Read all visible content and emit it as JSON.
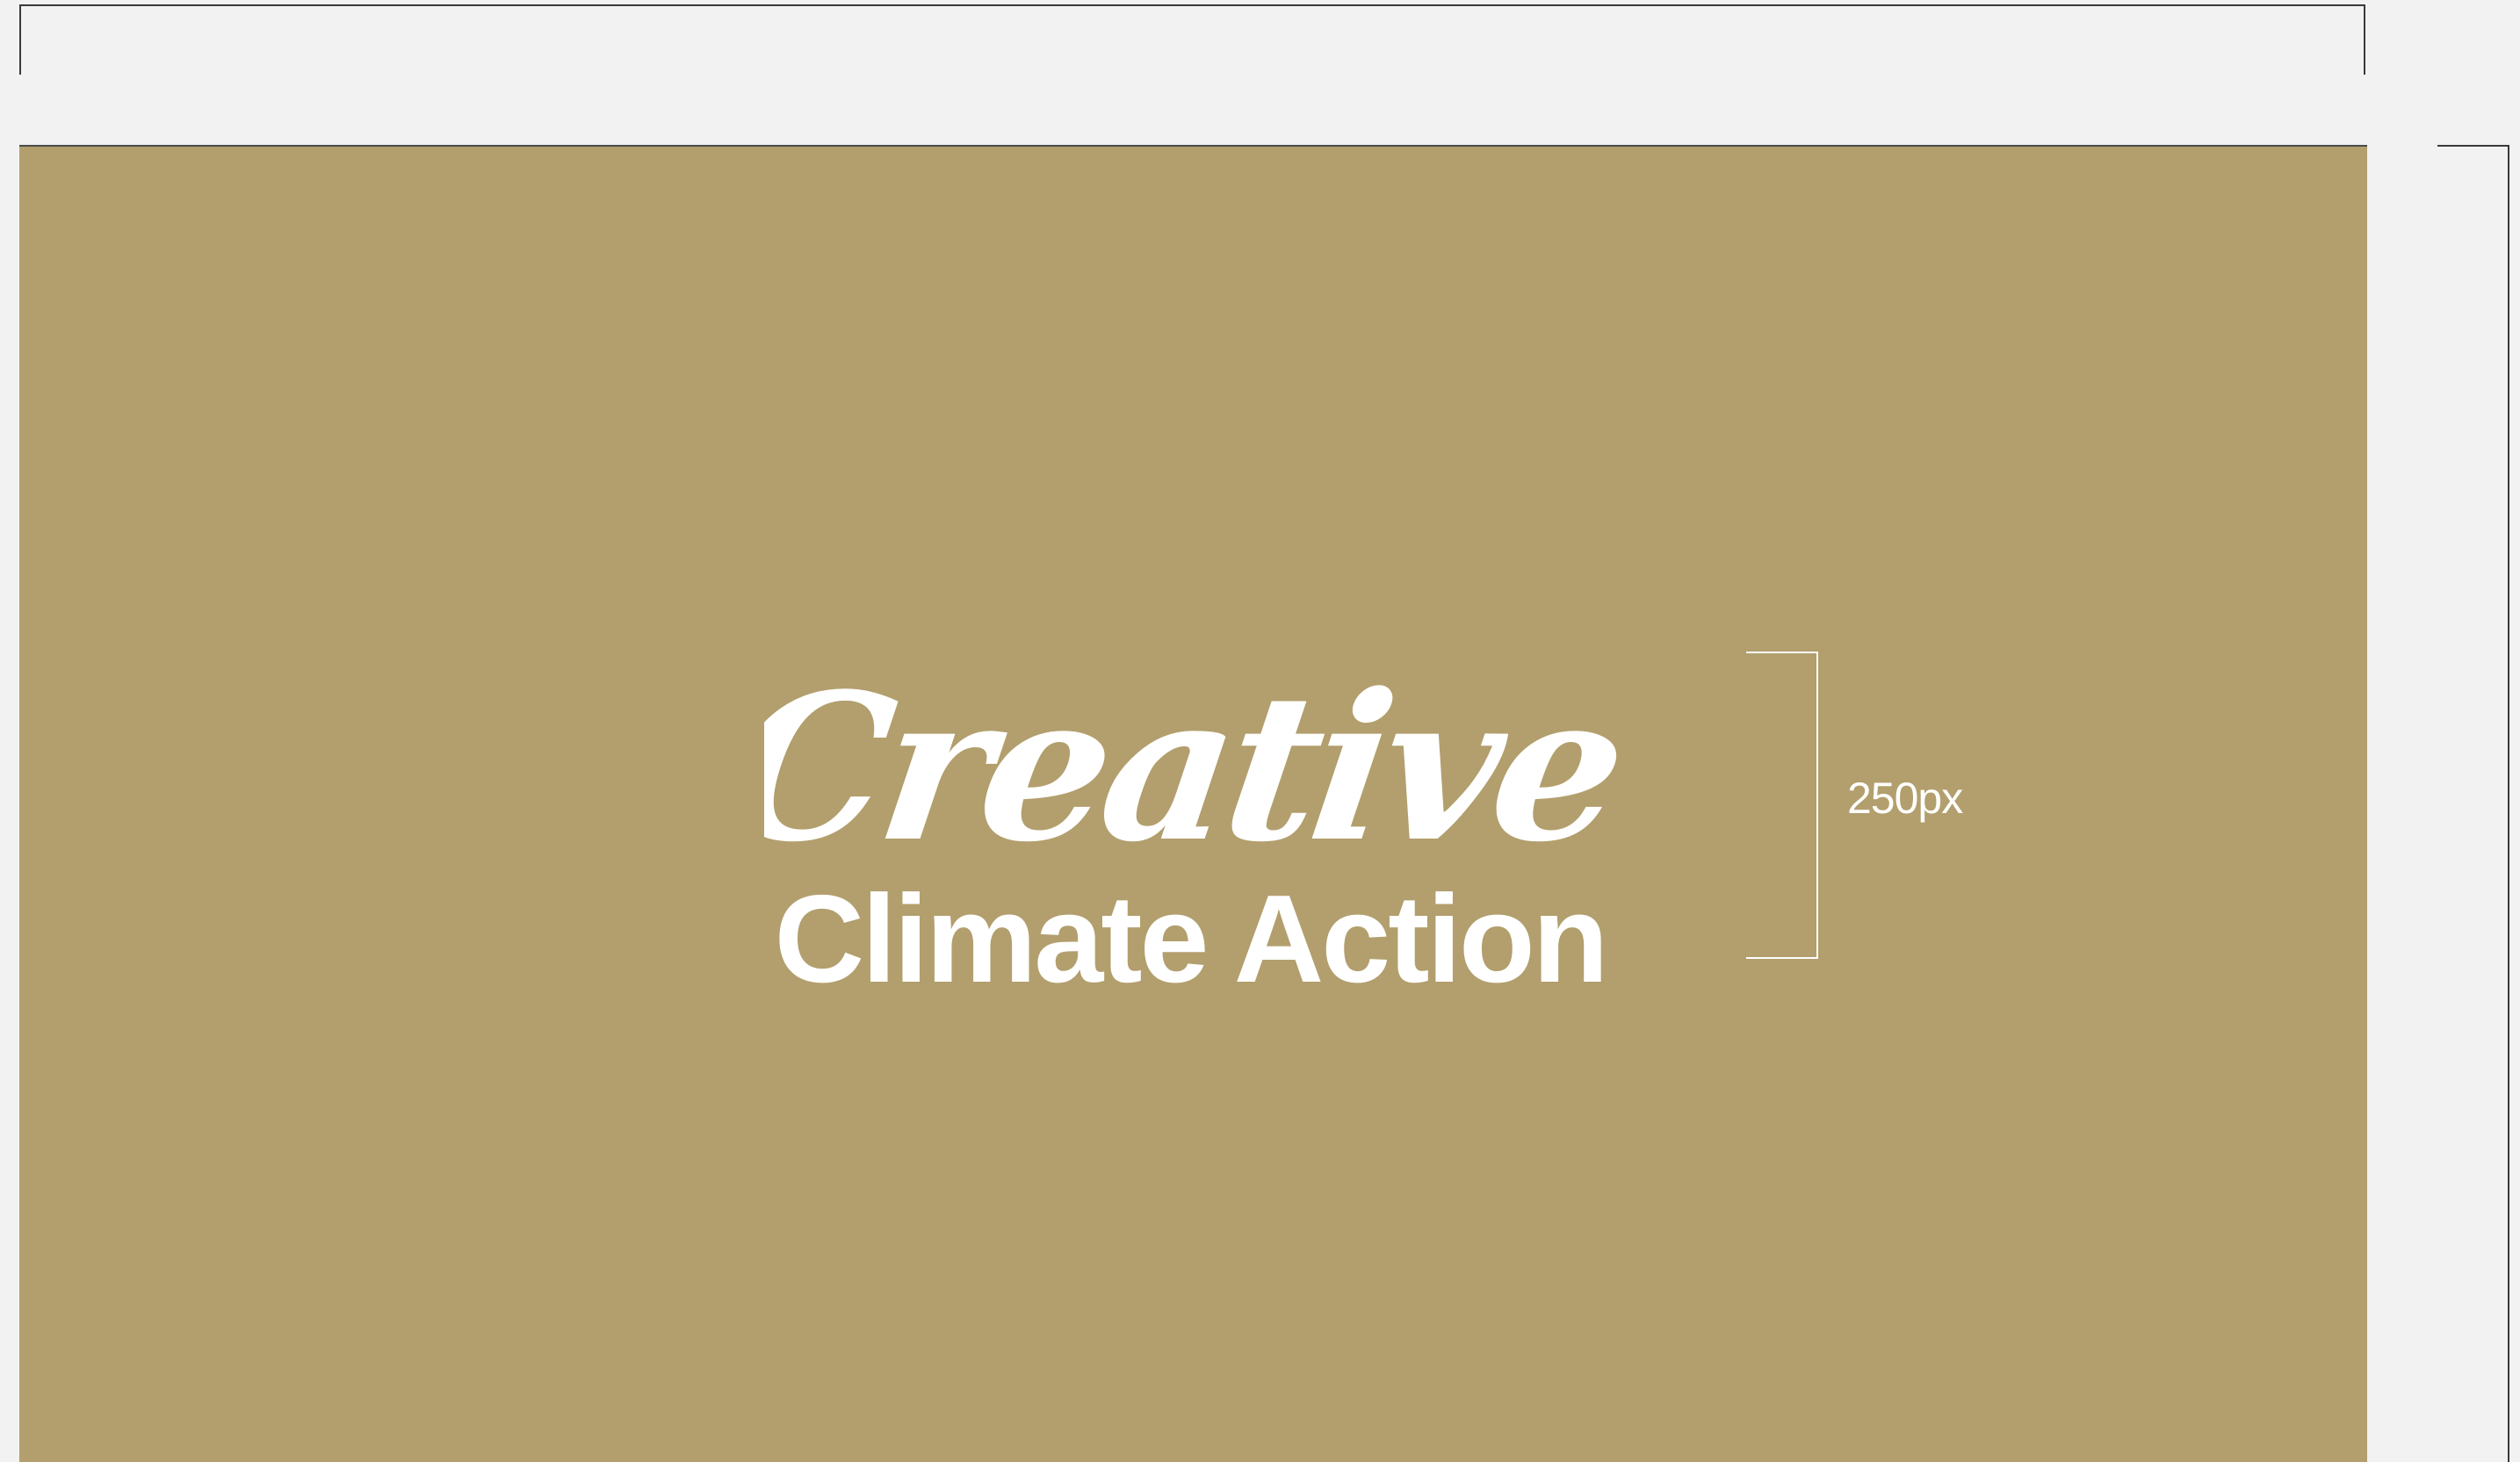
{
  "logo": {
    "script_word": "Creative",
    "wordmark": "Climate Action"
  },
  "measurement": {
    "label": "250px"
  },
  "colors": {
    "canvas_background": "#f2f2f2",
    "artboard_background": "#b29f6d",
    "logo_color": "#ffffff",
    "frame_line": "#3a3a3a"
  }
}
